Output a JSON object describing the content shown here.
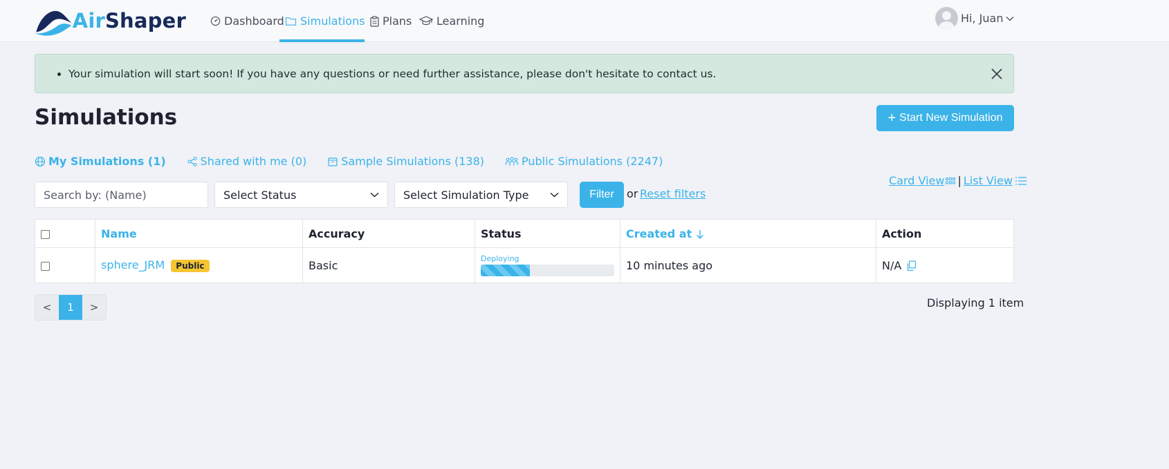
{
  "brand": {
    "air": "Air",
    "shaper": "Shaper"
  },
  "nav": [
    {
      "label": "Dashboard",
      "icon": "gauge-icon"
    },
    {
      "label": "Simulations",
      "icon": "folder-icon",
      "active": true
    },
    {
      "label": "Plans",
      "icon": "clipboard-icon"
    },
    {
      "label": "Learning",
      "icon": "graduation-cap-icon"
    }
  ],
  "user": {
    "greeting": "Hi, Juan"
  },
  "alert": {
    "message": "Your simulation will start soon! If you have any questions or need further assistance, please don't hesitate to contact us."
  },
  "page": {
    "title": "Simulations",
    "new_button": "Start New Simulation"
  },
  "tabs": [
    {
      "label": "My Simulations (1)",
      "active": true
    },
    {
      "label": "Shared with me (0)"
    },
    {
      "label": "Sample Simulations (138)"
    },
    {
      "label": "Public Simulations (2247)"
    }
  ],
  "views": {
    "card": "Card View",
    "sep": "|",
    "list": "List View"
  },
  "filters": {
    "search_placeholder": "Search by: (Name)",
    "status": "Select Status",
    "type": "Select Simulation Type",
    "filter_button": "Filter",
    "or": "or",
    "reset": "Reset filters"
  },
  "table": {
    "headers": {
      "name": "Name",
      "accuracy": "Accuracy",
      "status": "Status",
      "created": "Created at",
      "action": "Action"
    },
    "rows": [
      {
        "name": "sphere_JRM",
        "badge": "Public",
        "accuracy": "Basic",
        "status": "Deploying",
        "progress": 0.37,
        "created": "10 minutes ago",
        "action": "N/A"
      }
    ]
  },
  "pagination": {
    "prev": "<",
    "page": "1",
    "next": ">",
    "summary": "Displaying 1 item"
  },
  "colors": {
    "accent": "#3bb3e8",
    "navy": "#172a5b",
    "alert_bg": "#d4e8df",
    "badge": "#f6c531"
  }
}
